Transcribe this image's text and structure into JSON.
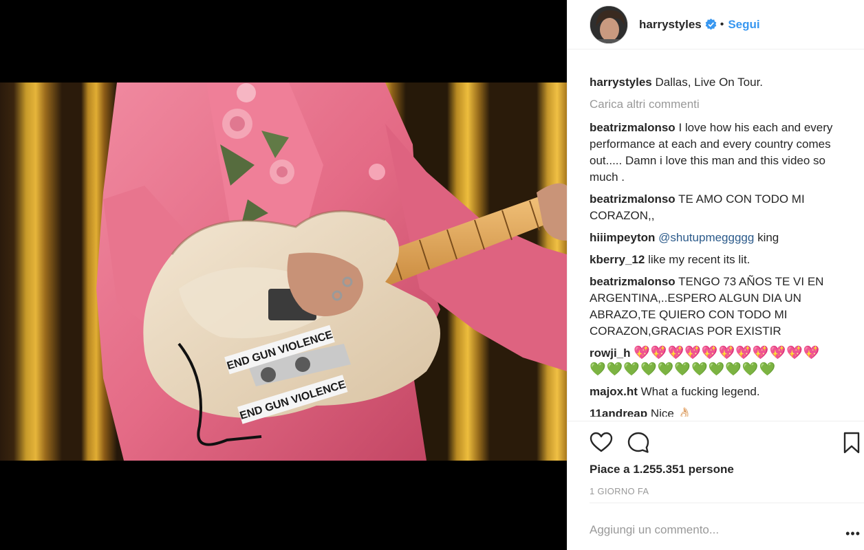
{
  "header": {
    "username": "harrystyles",
    "separator": "•",
    "follow_label": "Segui",
    "verified_icon": "verified-badge-icon",
    "verified_color": "#3897f0"
  },
  "post": {
    "image_description": "guitar-photo",
    "sticker_text_top": "END GUN VIOLENCE",
    "sticker_text_bottom": "END GUN VIOLENCE",
    "caption_user": "harrystyles",
    "caption_text": "Dallas, Live On Tour."
  },
  "load_more_label": "Carica altri commenti",
  "comments": [
    {
      "user": "beatrizmalonso",
      "text": "I love how his each and every performance at each and every country comes out..... Damn i love this man and this video so much ."
    },
    {
      "user": "beatrizmalonso",
      "text": "TE AMO CON TODO MI CORAZON,,"
    },
    {
      "user": "hiiimpeyton",
      "mention": "@shutupmeggggg",
      "text": "king"
    },
    {
      "user": "kberry_12",
      "text": "like my recent its lit."
    },
    {
      "user": "beatrizmalonso",
      "text": "TENGO 73 AÑOS TE VI EN ARGENTINA,..ESPERO ALGUN DIA UN ABRAZO,TE QUIERO CON TODO MI CORAZON,GRACIAS POR EXISTIR"
    },
    {
      "user": "rowji_h",
      "emoji_red": "💖💖💖💖💖💖💖💖💖💖💖",
      "emoji_green": "💚💚💚💚💚💚💚💚💚💚💚"
    },
    {
      "user": "majox.ht",
      "text": "What a fucking legend."
    },
    {
      "user": "11andreap",
      "text": "Nice 👌🏻"
    }
  ],
  "actions": {
    "like_icon": "heart-icon",
    "comment_icon": "comment-bubble-icon",
    "save_icon": "bookmark-icon",
    "likes_text": "Piace a 1.255.351 persone",
    "time_text": "1 GIORNO FA"
  },
  "add_comment": {
    "placeholder": "Aggiungi un commento...",
    "more_label": "•••"
  },
  "colors": {
    "link_blue": "#3897f0",
    "mention_blue": "#2b5a8a",
    "muted": "#999999",
    "text": "#262626",
    "jacket_pink": "#e8708a"
  }
}
